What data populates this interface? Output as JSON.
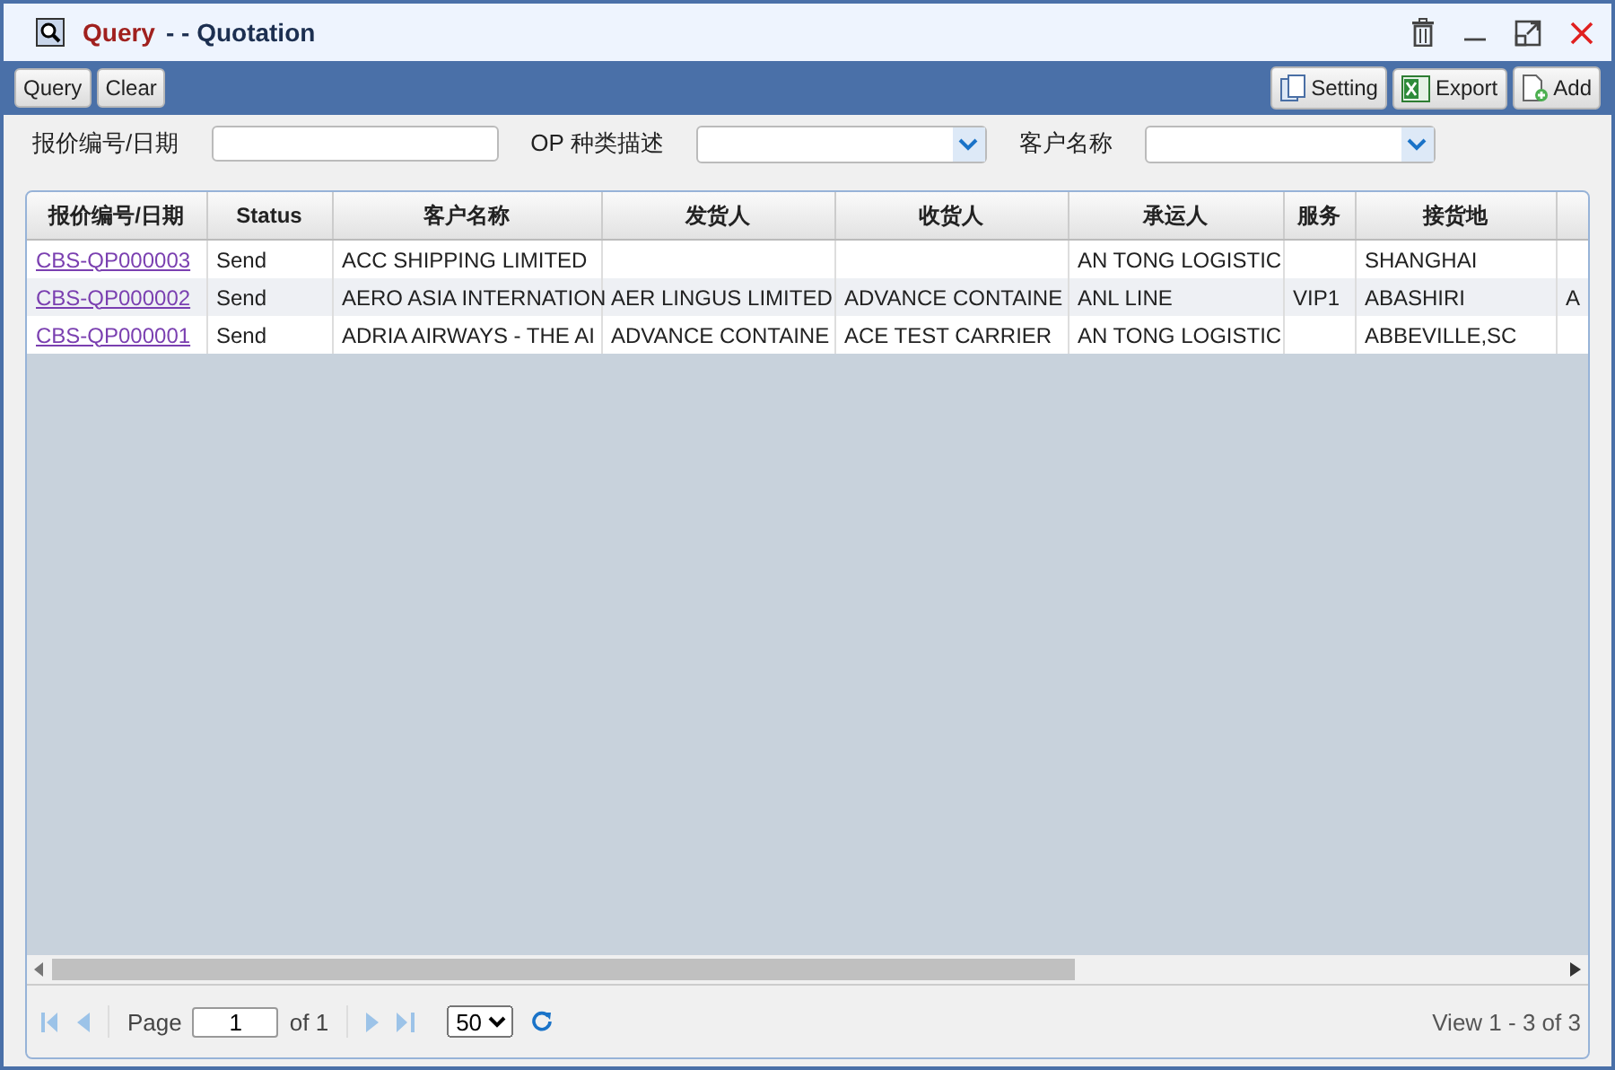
{
  "window": {
    "title": "Query",
    "subtitle": "- - Quotation"
  },
  "toolbar": {
    "left_buttons": [
      "Query",
      "Clear"
    ],
    "right_buttons": [
      {
        "label": "Setting",
        "kind": "setting"
      },
      {
        "label": "Export",
        "kind": "export"
      },
      {
        "label": "Add",
        "kind": "add"
      }
    ]
  },
  "filters": [
    {
      "label": "报价编号/日期",
      "kind": "text"
    },
    {
      "label": "OP 种类描述",
      "kind": "select"
    },
    {
      "label": "客户名称",
      "kind": "select"
    }
  ],
  "table": {
    "columns": [
      "报价编号/日期",
      "Status",
      "客户名称",
      "发货人",
      "收货人",
      "承运人",
      "服务",
      "接货地"
    ],
    "rows": [
      [
        "CBS-QP000003",
        "Send",
        "ACC SHIPPING LIMITED",
        null,
        null,
        "AN TONG LOGISTIC",
        null,
        "SHANGHAI",
        null
      ],
      [
        "CBS-QP000002",
        "Send",
        "AERO ASIA INTERNATION",
        "AER LINGUS LIMITED",
        "ADVANCE CONTAINE",
        "ANL LINE",
        "VIP1",
        "ABASHIRI",
        "A"
      ],
      [
        "CBS-QP000001",
        "Send",
        "ADRIA AIRWAYS - THE AI",
        "ADVANCE CONTAINE",
        "ACE TEST CARRIER",
        "AN TONG LOGISTIC",
        null,
        "ABBEVILLE,SC",
        null
      ]
    ]
  },
  "pager": {
    "page_label": "Page",
    "page": "1",
    "of_label": "of 1",
    "page_size": "50",
    "summary": "View 1 - 3 of 3"
  }
}
